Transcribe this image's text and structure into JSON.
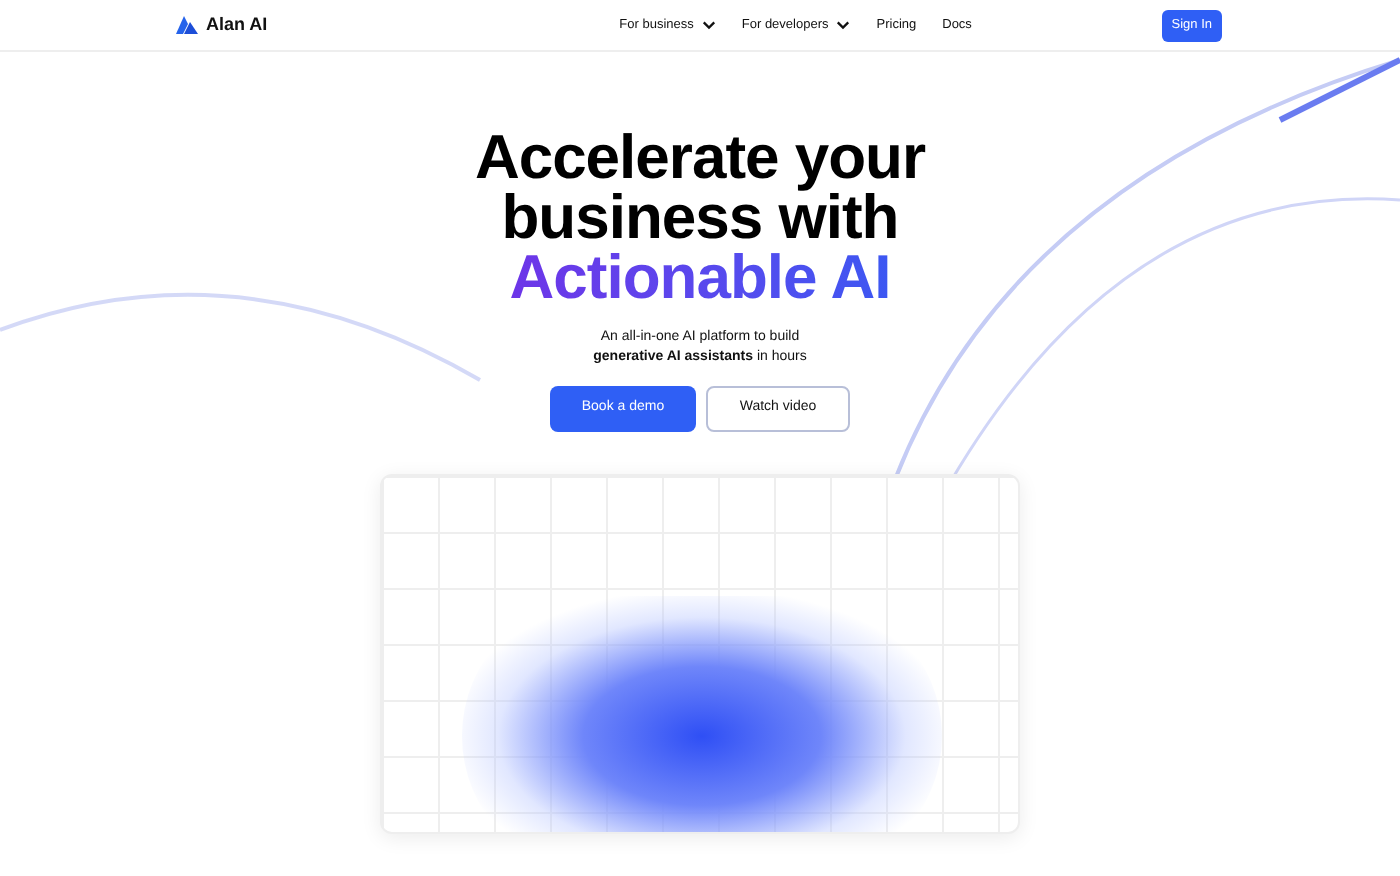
{
  "nav": {
    "logo": "Alan AI",
    "links": [
      {
        "label": "For business",
        "dropdown": true
      },
      {
        "label": "For developers",
        "dropdown": true
      },
      {
        "label": "Pricing",
        "dropdown": false
      },
      {
        "label": "Docs",
        "dropdown": false
      }
    ],
    "sign_in": "Sign In"
  },
  "hero": {
    "title_lines": [
      "Accelerate your",
      "business with"
    ],
    "title_highlight": "Actionable AI",
    "subtitle_lines": [
      "An all-in-one AI platform to build",
      "**generative AI assistants** in hours"
    ],
    "primary_button": "Book a demo",
    "secondary_button": "Watch video"
  }
}
